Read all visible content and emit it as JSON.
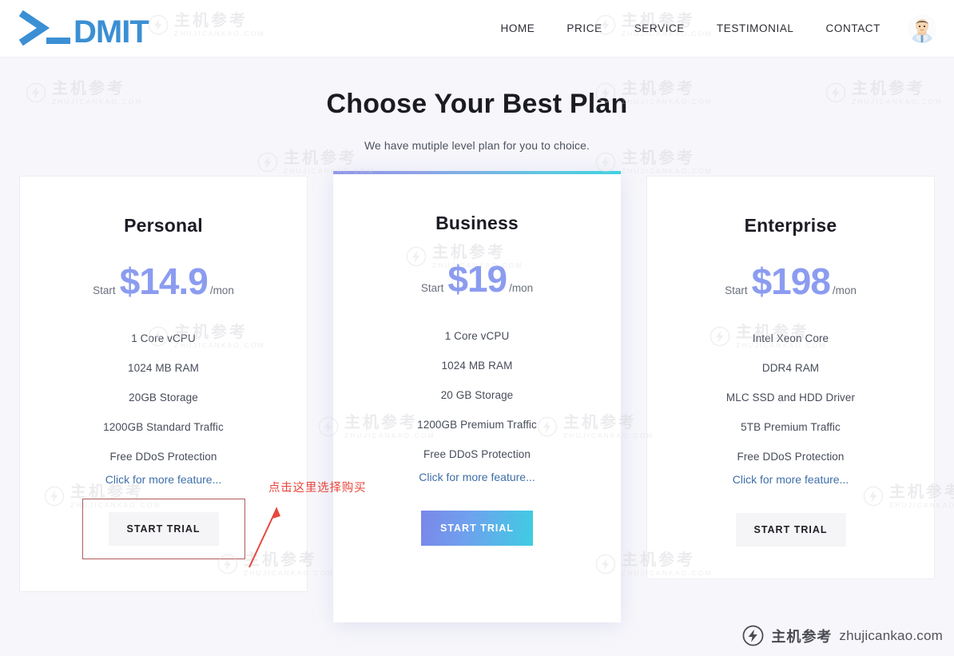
{
  "header": {
    "logo_text": ">_DMIT",
    "logo_color": "#3b8fd4",
    "nav": [
      {
        "label": "HOME",
        "name": "nav-item-home"
      },
      {
        "label": "PRICE",
        "name": "nav-item-price"
      },
      {
        "label": "SERVICE",
        "name": "nav-item-service"
      },
      {
        "label": "TESTIMONIAL",
        "name": "nav-item-testimonial"
      },
      {
        "label": "CONTACT",
        "name": "nav-item-contact"
      }
    ],
    "avatar_icon": "user-avatar-icon"
  },
  "hero": {
    "title": "Choose Your Best Plan",
    "subtitle": "We have mutiple level plan for you to choice."
  },
  "plans": [
    {
      "name": "Personal",
      "start_label": "Start",
      "price": "$14.9",
      "per": "/mon",
      "features": [
        "1 Core vCPU",
        "1024 MB RAM",
        "20GB Storage",
        "1200GB Standard Traffic",
        "Free DDoS Protection"
      ],
      "more_link": "Click for more feature...",
      "button_label": "START TRIAL",
      "featured": false,
      "highlighted": true
    },
    {
      "name": "Business",
      "start_label": "Start",
      "price": "$19",
      "per": "/mon",
      "features": [
        "1 Core vCPU",
        "1024 MB RAM",
        "20 GB Storage",
        "1200GB Premium Traffic",
        "Free DDoS Protection"
      ],
      "more_link": "Click for more feature...",
      "button_label": "START TRIAL",
      "featured": true,
      "highlighted": false
    },
    {
      "name": "Enterprise",
      "start_label": "Start",
      "price": "$198",
      "per": "/mon",
      "features": [
        "Intel Xeon Core",
        "DDR4 RAM",
        "MLC SSD and HDD Driver",
        "5TB Premium Traffic",
        "Free DDoS Protection"
      ],
      "more_link": "Click for more feature...",
      "button_label": "START TRIAL",
      "featured": false,
      "highlighted": false
    }
  ],
  "annotation": {
    "text": "点击这里选择购买",
    "color": "#e8463c",
    "arrow_icon": "red-arrow-icon"
  },
  "watermark": {
    "cn": "主机参考",
    "en": "ZHUJICANKAO.COM",
    "logo_icon": "circle-lightning-icon"
  },
  "brand_badge": {
    "cn": "主机参考",
    "url": "zhujicankao.com",
    "logo_icon": "circle-lightning-icon"
  },
  "colors": {
    "price": "#8b9cf0",
    "link": "#3f6fa8",
    "accent_gradient_start": "#7b87e8",
    "accent_gradient_end": "#3ecde2",
    "annotation": "#e8463c",
    "page_bg": "#f7f7fb"
  }
}
